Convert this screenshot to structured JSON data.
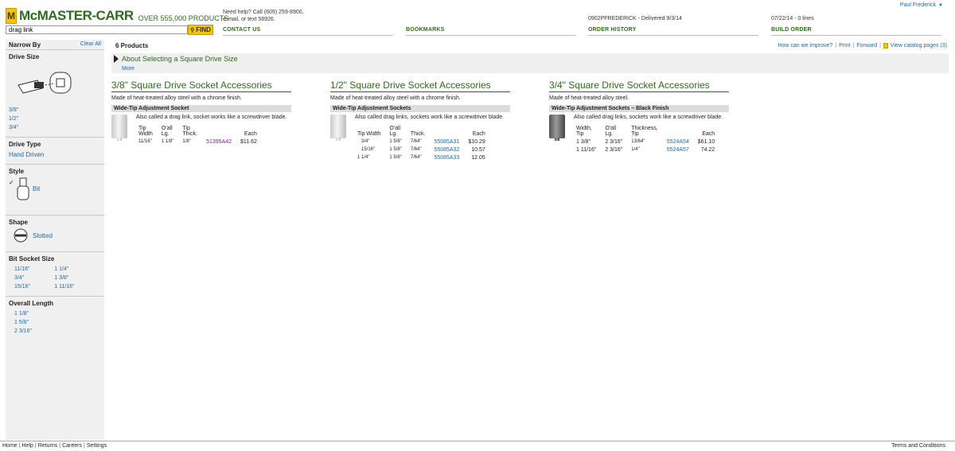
{
  "header": {
    "logo_badge": "M",
    "logo_text": "McMASTER-CARR",
    "logo_tagline": "OVER 555,000 PRODUCTS",
    "search_value": "drag link",
    "find_label": "FIND",
    "help_line1": "Need help? Call (609) 259-8900,",
    "help_line2": "e-mail, or text 58926.",
    "nav": [
      "CONTACT US",
      "BOOKMARKS",
      "ORDER HISTORY",
      "BUILD ORDER"
    ],
    "order_info": "0902PFREDERICK - Delivered 9/3/14",
    "order_date": "07/22/14 - 0 lines",
    "user_name": "Paul Frederick",
    "user_arrow": "▼"
  },
  "sidebar": {
    "title": "Narrow By",
    "clear_all": "Clear All",
    "drive_size": {
      "title": "Drive Size",
      "options": [
        "3/8\"",
        "1/2\"",
        "3/4\""
      ]
    },
    "drive_type": {
      "title": "Drive Type",
      "options": [
        "Hand Driven"
      ]
    },
    "style": {
      "title": "Style",
      "check": "✓",
      "options": [
        "Bit"
      ]
    },
    "shape": {
      "title": "Shape",
      "options": [
        "Slotted"
      ]
    },
    "bit_socket_size": {
      "title": "Bit Socket Size",
      "col1": [
        "11/16\"",
        "3/4\"",
        "15/16\""
      ],
      "col2": [
        "1 1/4\"",
        "1 3/8\"",
        "1 11/16\""
      ]
    },
    "overall_length": {
      "title": "Overall Length",
      "options": [
        "1 1/8\"",
        "1 5/8\"",
        "2 3/16\""
      ]
    }
  },
  "main": {
    "count": "6 Products",
    "links": [
      "How can we improve?",
      "Print",
      "Forward",
      "View catalog pages (3)"
    ],
    "about_title": "About Selecting a Square Drive Size",
    "about_more": "More"
  },
  "products": [
    {
      "title": "3/8\" Square Drive Socket Accessories",
      "desc": "Made of heat-treated alloy steel with a chrome finish.",
      "sub": "Wide-Tip Adjustment Socket",
      "note": "Also called a drag link, socket works like a screwdriver blade.",
      "headers": [
        [
          "Tip",
          "Width"
        ],
        [
          "O'all",
          "Lg."
        ],
        [
          "Tip",
          "Thick."
        ],
        [
          "",
          ""
        ],
        [
          "",
          "Each"
        ]
      ],
      "rows": [
        [
          "11/16\"",
          "1 1/8\"",
          "1/8\"",
          "51395A42",
          "$11.62"
        ]
      ]
    },
    {
      "title": "1/2\" Square Drive Socket Accessories",
      "desc": "Made of heat-treated alloy steel with a chrome finish.",
      "sub": "Wide-Tip Adjustment Sockets",
      "note": "Also called drag links, sockets work like a screwdriver blade.",
      "headers": [
        [
          "",
          "Tip Width"
        ],
        [
          "O'all",
          "Lg."
        ],
        [
          "",
          "Thick."
        ],
        [
          "",
          ""
        ],
        [
          "",
          "Each"
        ]
      ],
      "rows": [
        [
          "3/4\"",
          "1 5/8\"",
          "7/64\"",
          "55085A31",
          "$10.29"
        ],
        [
          "15/16\"",
          "1 5/8\"",
          "7/64\"",
          "55085A32",
          "10.57"
        ],
        [
          "1 1/4\"",
          "1 5/8\"",
          "7/64\"",
          "55085A33",
          "12.05"
        ]
      ]
    },
    {
      "title": "3/4\" Square Drive Socket Accessories",
      "desc": "Made of heat-treated alloy steel.",
      "sub": "Wide-Tip Adjustment Sockets – Black Finish",
      "note": "Also called drag links, sockets work like a screwdriver blade.",
      "headers": [
        [
          "Width,",
          "Tip"
        ],
        [
          "O'all",
          "Lg."
        ],
        [
          "Thickness,",
          "Tip"
        ],
        [
          "",
          ""
        ],
        [
          "",
          "Each"
        ]
      ],
      "rows": [
        [
          "1 3/8\"",
          "2 3/16\"",
          "13/64\"",
          "5524A54",
          "$61.10"
        ],
        [
          "1 11/16\"",
          "2 3/16\"",
          "1/4\"",
          "5524A57",
          "74.22"
        ]
      ]
    }
  ],
  "footer": {
    "links": [
      "Home",
      "Help",
      "Returns",
      "Careers",
      "Settings"
    ],
    "terms": "Terms and Conditions"
  }
}
